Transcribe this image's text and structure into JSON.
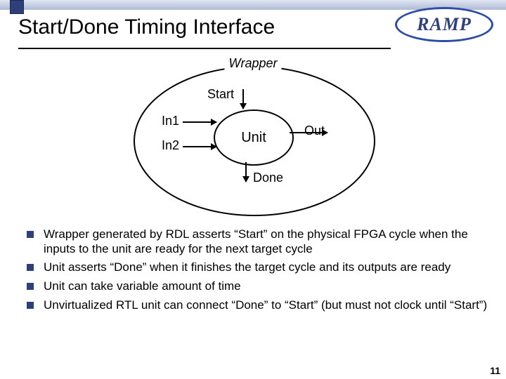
{
  "title": "Start/Done Timing Interface",
  "logo": "RAMP",
  "page_number": "11",
  "diagram": {
    "outer_label": "Wrapper",
    "inner_label": "Unit",
    "start": "Start",
    "done": "Done",
    "in1": "In1",
    "in2": "In2",
    "out": "Out"
  },
  "bullets": [
    "Wrapper generated by RDL asserts “Start” on the physical FPGA cycle when the inputs to the unit are ready for the next target cycle",
    "Unit asserts “Done” when it finishes the target cycle and its outputs are ready",
    "Unit can take variable amount of time",
    "Unvirtualized RTL unit can connect “Done” to “Start” (but must not clock until “Start”)"
  ]
}
